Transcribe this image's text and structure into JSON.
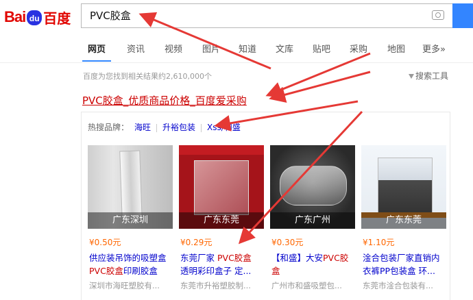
{
  "logo": {
    "part1": "Bai",
    "paw": "du",
    "part2": "百度"
  },
  "search": {
    "query": "PVC胶盒"
  },
  "tabs": [
    {
      "label": "网页",
      "active": true
    },
    {
      "label": "资讯"
    },
    {
      "label": "视频"
    },
    {
      "label": "图片"
    },
    {
      "label": "知道"
    },
    {
      "label": "文库"
    },
    {
      "label": "贴吧"
    },
    {
      "label": "采购"
    },
    {
      "label": "地图"
    },
    {
      "label": "更多»"
    }
  ],
  "results": {
    "count_text": "百度为您找到相关结果约2,610,000个",
    "tools_label": "搜索工具"
  },
  "result": {
    "title": "PVC胶盒_优质商品价格_百度爱采购",
    "hot_label": "热搜品牌：",
    "brands": [
      "海旺",
      "升裕包装",
      "Xss/和盛"
    ]
  },
  "products": [
    {
      "location": "广东深圳",
      "price": "¥0.50元",
      "desc1": "供应装吊饰的吸塑盒",
      "desc2_hl": "PVC胶盒",
      "desc2": "印刷胶盒",
      "shop": "深圳市海旺塑胶有..."
    },
    {
      "location": "广东东莞",
      "price": "¥0.29元",
      "desc1a": "东莞厂家 ",
      "desc1_hl": "PVC胶盒",
      "desc2": "透明彩印盒子 定...",
      "shop": "东莞市升裕塑胶制..."
    },
    {
      "location": "广东广州",
      "price": "¥0.30元",
      "desc1a": "【和盛】大安",
      "desc1_hl": "PVC胶",
      "desc2": "盒",
      "shop": "广州市和盛吸塑包..."
    },
    {
      "location": "广东东莞",
      "price": "¥1.10元",
      "desc1": "淦合包装厂家直销内",
      "desc2": "衣裤PP包装盒 环...",
      "shop": "东莞市淦合包装有..."
    }
  ],
  "colors": {
    "accent": "#3385ff",
    "title_red": "#cc0000",
    "link_blue": "#0000cc",
    "price_orange": "#ff6600",
    "annotation_arrow": "#e53935"
  }
}
